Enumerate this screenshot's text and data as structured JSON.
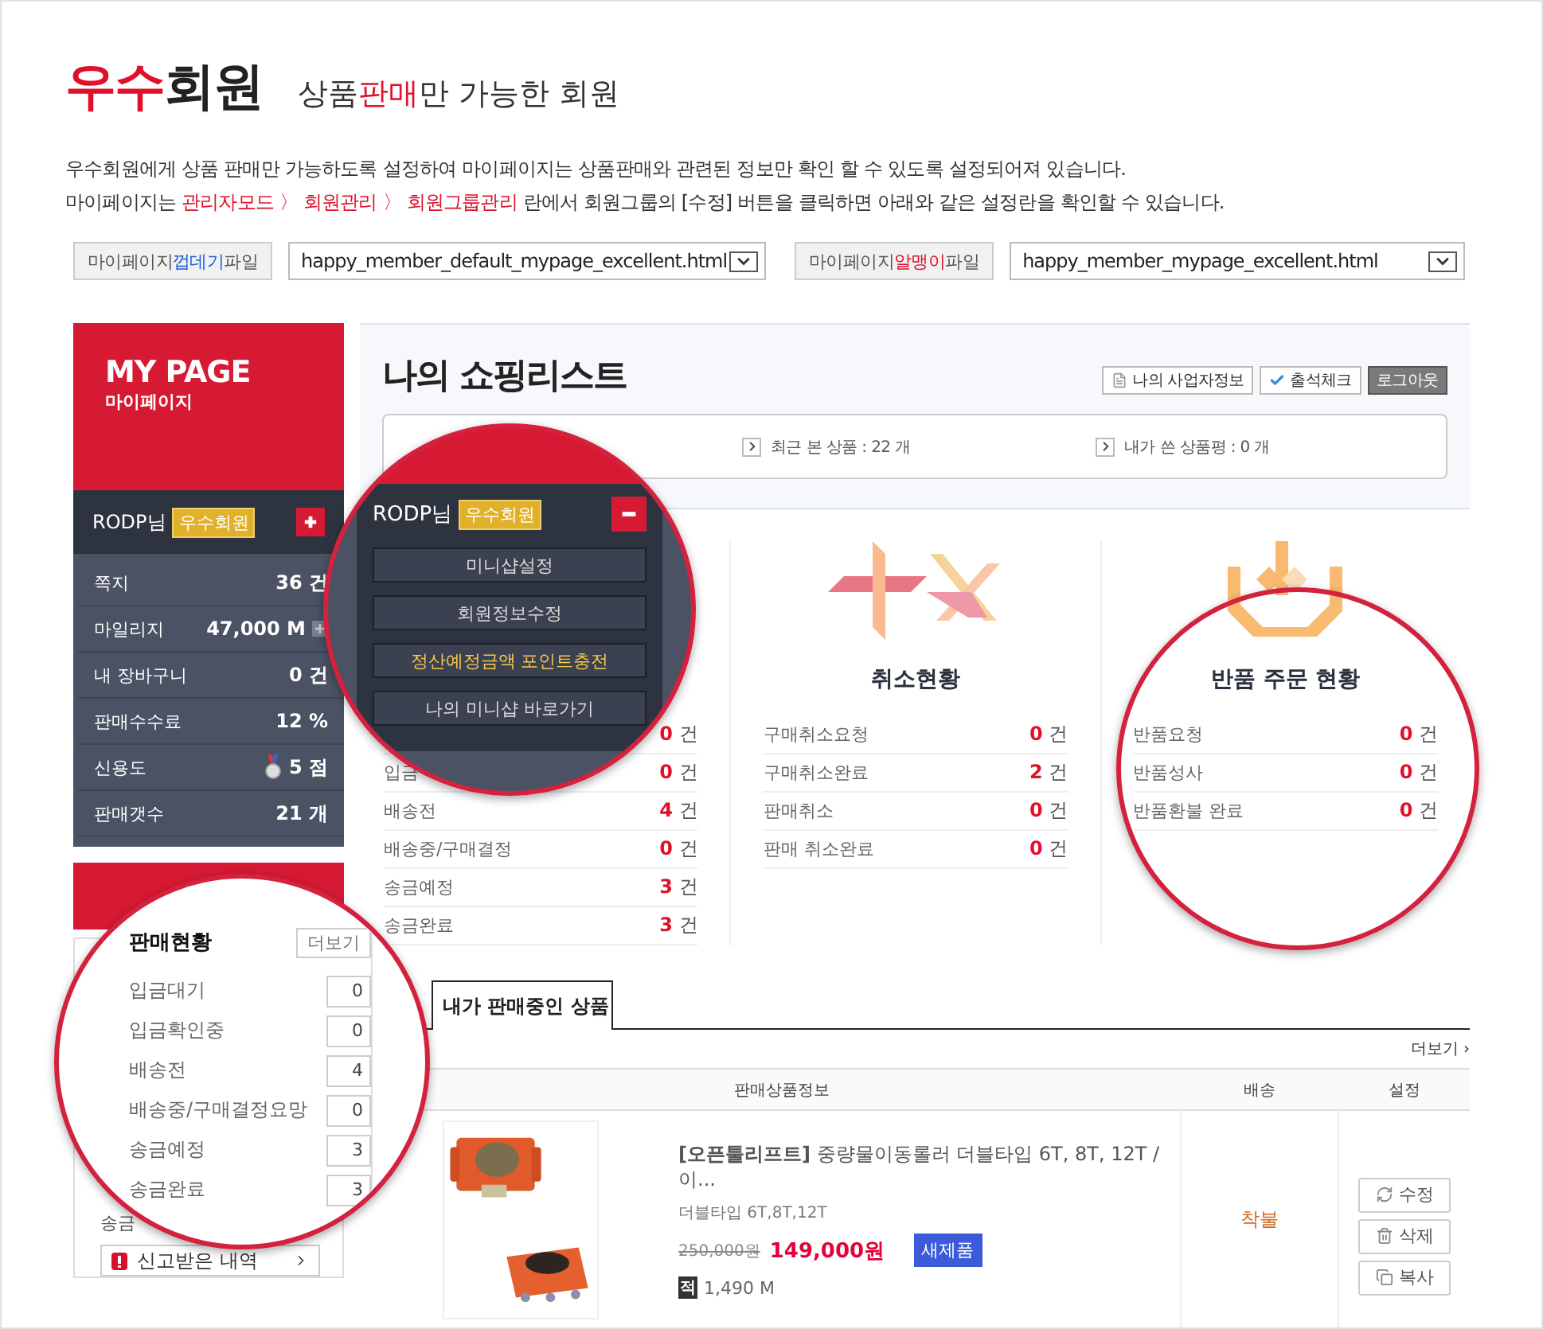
{
  "header": {
    "title": [
      {
        "text": "우수",
        "highlight": true
      },
      {
        "text": "회원",
        "highlight": false
      }
    ],
    "subtitle": [
      {
        "text": "상품",
        "highlight": false
      },
      {
        "text": "판매",
        "highlight": true
      },
      {
        "text": "만 가능한 회원",
        "highlight": false
      }
    ]
  },
  "description": [
    [
      {
        "text": "우수회원에게 상품 판매만 가능하도록 설정하여 마이페이지는 상품판매와 관련된 정보만 확인 할 수 있도록 설정되어져 있습니다.",
        "highlight": false
      }
    ],
    [
      {
        "text": "마이페이지는 ",
        "highlight": false
      },
      {
        "text": "관리자모드 〉 회원관리 〉 회원그룹관리",
        "highlight": true
      },
      {
        "text": " 란에서 회원그룹의 [수정] 버튼을 클릭하면 아래와 같은 설정란을 확인할 수 있습니다.",
        "highlight": false
      }
    ]
  ],
  "file_selectors": [
    {
      "label": [
        {
          "text": "마이페이지 ",
          "color": "#555555"
        },
        {
          "text": "껍데기",
          "color": "#1a5fd6"
        },
        {
          "text": "파일",
          "color": "#555555"
        }
      ],
      "value": "happy_member_default_mypage_excellent.html"
    },
    {
      "label": [
        {
          "text": "마이페이지 ",
          "color": "#555555"
        },
        {
          "text": "알맹이",
          "color": "#e0102a"
        },
        {
          "text": "파일",
          "color": "#555555"
        }
      ],
      "value": "happy_member_mypage_excellent.html"
    }
  ],
  "sidebar": {
    "title": "MY PAGE",
    "subtitle": "마이페이지",
    "user": {
      "name": "RODP님",
      "grade": "우수회원",
      "expanded": false
    },
    "stats": [
      {
        "label": "쪽지",
        "value": "36 건",
        "kind": "plain"
      },
      {
        "label": "마일리지",
        "value": "47,000 M",
        "kind": "mileage"
      },
      {
        "label": "내 장바구니",
        "value": "0 건",
        "kind": "plain"
      },
      {
        "label": "판매수수료",
        "value": "12 %",
        "kind": "plain"
      },
      {
        "label": "신용도",
        "value": "5 점",
        "kind": "medal"
      },
      {
        "label": "판매갯수",
        "value": "21 개",
        "kind": "plain"
      }
    ],
    "sales_box": {
      "label": "송금",
      "report_button": "신고받은 내역"
    }
  },
  "shopping": {
    "title": "나의 쇼핑리스트",
    "buttons": [
      {
        "label": "나의 사업자정보",
        "kind": "info"
      },
      {
        "label": "출석체크",
        "kind": "check"
      },
      {
        "label": "로그아웃",
        "kind": "dark"
      }
    ],
    "summary": [
      {
        "label": "최근 본 상품 : 22 개"
      },
      {
        "label": "내가 쓴 상품평 : 0 개"
      }
    ]
  },
  "status_columns": [
    {
      "kind": "hidden",
      "rows": [
        {
          "value": "0",
          "unit": "건"
        },
        {
          "label": "입금",
          "value": "0",
          "unit": "건"
        },
        {
          "label": "배송전",
          "value": "4",
          "unit": "건"
        },
        {
          "label": "배송중/구매결정",
          "value": "0",
          "unit": "건"
        },
        {
          "label": "송금예정",
          "value": "3",
          "unit": "건"
        },
        {
          "label": "송금완료",
          "value": "3",
          "unit": "건"
        }
      ]
    },
    {
      "kind": "cancel",
      "title": "취소현황",
      "rows": [
        {
          "label": "구매취소요청",
          "value": "0",
          "unit": "건"
        },
        {
          "label": "구매취소완료",
          "value": "2",
          "unit": "건"
        },
        {
          "label": "판매취소",
          "value": "0",
          "unit": "건"
        },
        {
          "label": "판매 취소완료",
          "value": "0",
          "unit": "건"
        }
      ]
    },
    {
      "kind": "return",
      "title": "반품 주문 현황",
      "rows": [
        {
          "label": "반품요청",
          "value": "0",
          "unit": "건"
        },
        {
          "label": "반품성사",
          "value": "0",
          "unit": "건"
        },
        {
          "label": "반품환불 완료",
          "value": "0",
          "unit": "건"
        }
      ]
    }
  ],
  "products": {
    "tab": "내가 판매중인 상품",
    "more": "더보기 ›",
    "columns": [
      "판매상품정보",
      "배송",
      "설정"
    ],
    "rows": [
      {
        "name": "**[오픈툴리프트]** 중량물이동롤러 더블타입 6T, 8T, 12T / 이...",
        "option": "더블타입 6T,8T,12T",
        "original_price": "250,000원",
        "price": "149,000원",
        "badge": "새제품",
        "points_mark": "적",
        "points": "1,490 M",
        "shipping": "착불",
        "actions": [
          {
            "label": "수정",
            "kind": "edit"
          },
          {
            "label": "삭제",
            "kind": "delete"
          },
          {
            "label": "복사",
            "kind": "copy"
          }
        ]
      }
    ]
  },
  "magnifiers": [
    {
      "kind": "user_menu",
      "user": "RODP님",
      "grade": "우수회원",
      "expanded": true,
      "menu": [
        {
          "label": "미니샵설정",
          "highlight": false
        },
        {
          "label": "회원정보수정",
          "highlight": false
        },
        {
          "label": "정산예정금액 포인트충전",
          "highlight": true
        },
        {
          "label": "나의 미니샵 바로가기",
          "highlight": false
        }
      ]
    },
    {
      "kind": "ring"
    },
    {
      "kind": "sales_panel",
      "title": "판매현황",
      "more": "더보기",
      "rows": [
        {
          "label": "입금대기",
          "value": "0"
        },
        {
          "label": "입금확인중",
          "value": "0"
        },
        {
          "label": "배송전",
          "value": "4"
        },
        {
          "label": "배송중/구매결정요망",
          "value": "0"
        },
        {
          "label": "송금예정",
          "value": "3"
        },
        {
          "label": "송금완료",
          "value": "3"
        }
      ]
    }
  ]
}
